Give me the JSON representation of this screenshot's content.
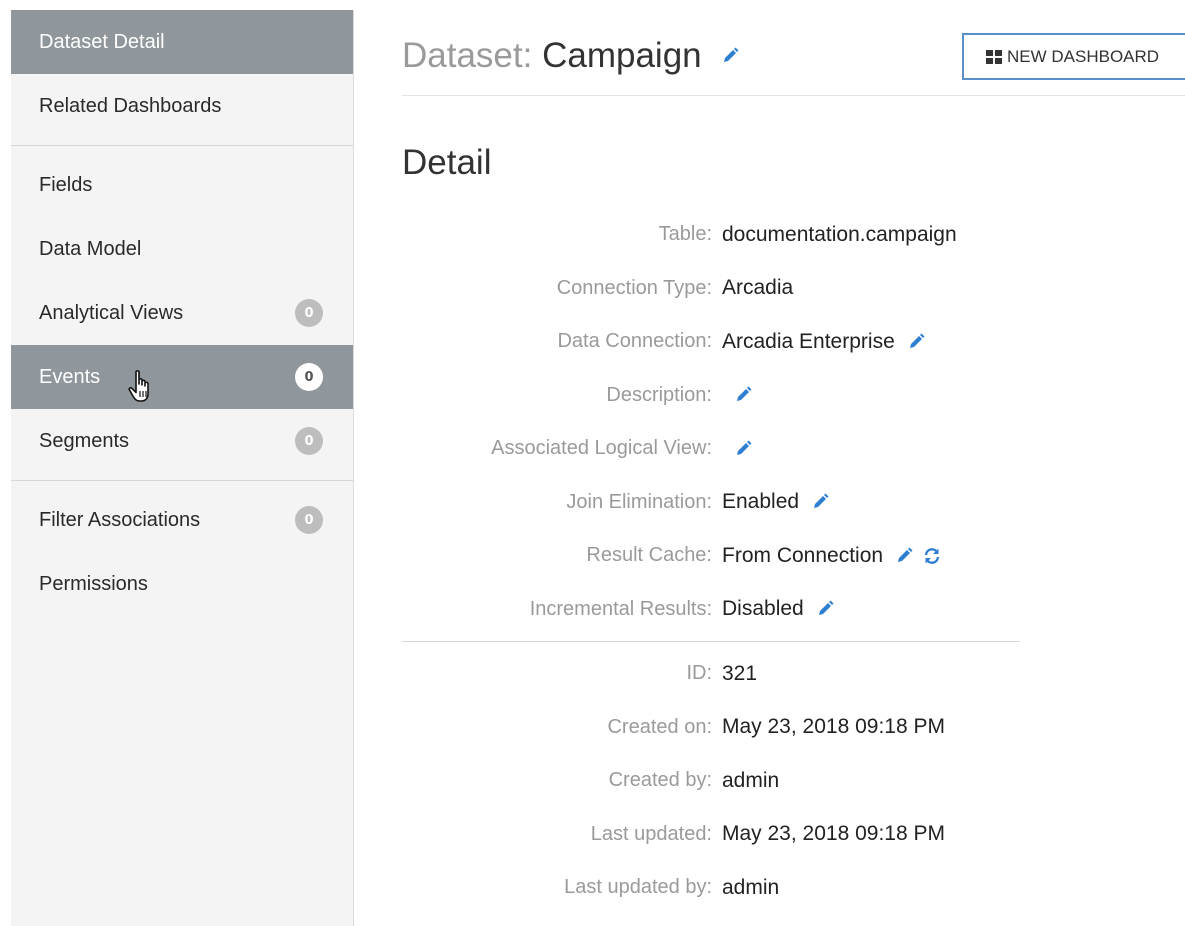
{
  "sidebar": {
    "items": [
      {
        "label": "Dataset Detail"
      },
      {
        "label": "Related Dashboards"
      },
      {
        "label": "Fields"
      },
      {
        "label": "Data Model"
      },
      {
        "label": "Analytical Views",
        "count": "0"
      },
      {
        "label": "Events",
        "count": "0"
      },
      {
        "label": "Segments",
        "count": "0"
      },
      {
        "label": "Filter Associations",
        "count": "0"
      },
      {
        "label": "Permissions"
      }
    ]
  },
  "header": {
    "title_prefix": "Dataset:",
    "title_name": "Campaign",
    "new_dashboard_label": "NEW DASHBOARD"
  },
  "detail": {
    "title": "Detail",
    "fields": [
      {
        "label": "Table:",
        "value": "documentation.campaign"
      },
      {
        "label": "Connection Type:",
        "value": "Arcadia"
      },
      {
        "label": "Data Connection:",
        "value": "Arcadia Enterprise"
      },
      {
        "label": "Description:",
        "value": ""
      },
      {
        "label": "Associated Logical View:",
        "value": ""
      },
      {
        "label": "Join Elimination:",
        "value": "Enabled"
      },
      {
        "label": "Result Cache:",
        "value": "From Connection"
      },
      {
        "label": "Incremental Results:",
        "value": "Disabled"
      }
    ],
    "meta": [
      {
        "label": "ID:",
        "value": "321"
      },
      {
        "label": "Created on:",
        "value": "May 23, 2018 09:18 PM"
      },
      {
        "label": "Created by:",
        "value": "admin"
      },
      {
        "label": "Last updated:",
        "value": "May 23, 2018 09:18 PM"
      },
      {
        "label": "Last updated by:",
        "value": "admin"
      }
    ]
  },
  "colors": {
    "accent": "#2f7fd1",
    "active_nav": "#8f979c",
    "badge": "#bdbdbd"
  },
  "icons": {
    "edit": "pencil-icon",
    "refresh": "refresh-icon",
    "grid": "grid-icon",
    "cursor": "hand-cursor-icon"
  }
}
